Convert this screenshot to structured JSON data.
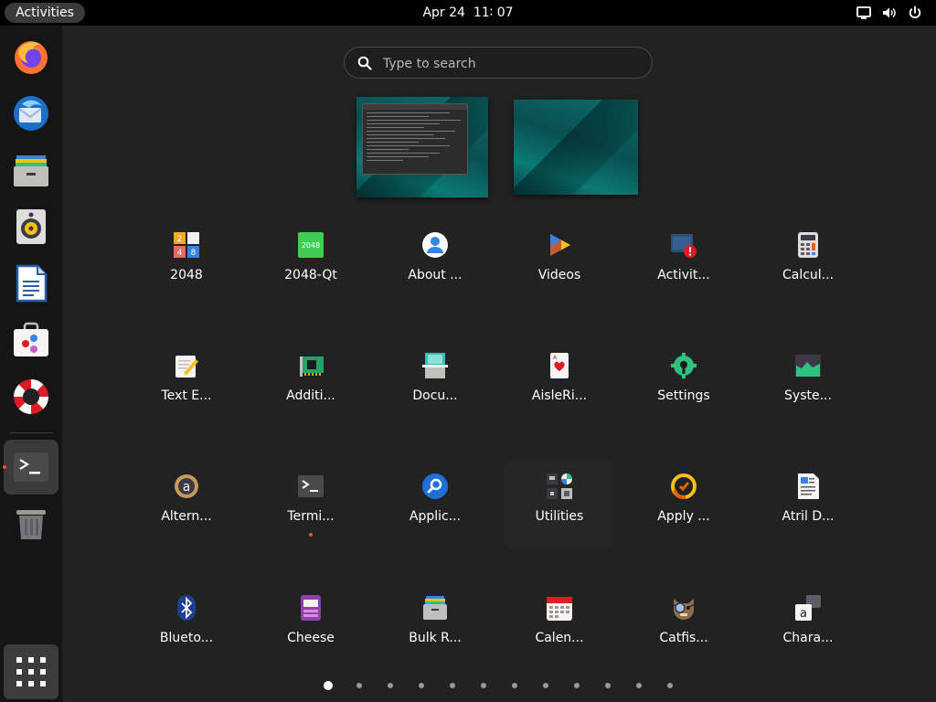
{
  "topbar": {
    "activities": "Activities",
    "date": "Apr 24",
    "time": "11∶ 07",
    "icons": [
      "screen-icon",
      "volume-icon",
      "power-icon"
    ]
  },
  "dock": {
    "favorites": [
      {
        "icon": "firefox-icon"
      },
      {
        "icon": "thunderbird-icon"
      },
      {
        "icon": "files-icon"
      },
      {
        "icon": "rhythmbox-icon"
      },
      {
        "icon": "writer-icon"
      },
      {
        "icon": "software-icon"
      },
      {
        "icon": "help-icon"
      }
    ],
    "running": [
      {
        "icon": "terminal-icon",
        "active": true
      }
    ],
    "trash": {
      "icon": "trash-icon"
    },
    "show_apps": {
      "icon": "grid-icon"
    }
  },
  "search": {
    "placeholder": "Type to search",
    "value": ""
  },
  "workspaces": [
    {
      "has_window": true
    },
    {
      "has_window": false
    }
  ],
  "apps": [
    {
      "label": "2048",
      "icon": "2048-icon"
    },
    {
      "label": "2048-Qt",
      "icon": "2048-qt-icon"
    },
    {
      "label": "About ...",
      "icon": "about-icon"
    },
    {
      "label": "Videos",
      "icon": "videos-icon"
    },
    {
      "label": "Activit...",
      "icon": "activity-log-icon"
    },
    {
      "label": "Calcul...",
      "icon": "calculator-icon"
    },
    {
      "label": "Text E...",
      "icon": "text-editor-icon"
    },
    {
      "label": "Additi...",
      "icon": "additional-drivers-icon"
    },
    {
      "label": "Docu...",
      "icon": "document-scanner-icon"
    },
    {
      "label": "AisleRi...",
      "icon": "aisleriot-icon"
    },
    {
      "label": "Settings",
      "icon": "settings-icon"
    },
    {
      "label": "Syste...",
      "icon": "system-monitor-icon"
    },
    {
      "label": "Altern...",
      "icon": "alternatives-icon"
    },
    {
      "label": "Termi...",
      "icon": "terminal-icon",
      "running": true
    },
    {
      "label": "Applic...",
      "icon": "app-finder-icon"
    },
    {
      "label": "Utilities",
      "icon": "utilities-folder-icon",
      "folder": true
    },
    {
      "label": "Apply ...",
      "icon": "apply-icon"
    },
    {
      "label": "Atril D...",
      "icon": "atril-icon"
    },
    {
      "label": "Blueto...",
      "icon": "bluetooth-icon"
    },
    {
      "label": "Cheese",
      "icon": "cheese-icon"
    },
    {
      "label": "Bulk R...",
      "icon": "bulk-rename-icon"
    },
    {
      "label": "Calen...",
      "icon": "calendar-icon"
    },
    {
      "label": "Catfis...",
      "icon": "catfish-icon"
    },
    {
      "label": "Chara...",
      "icon": "characters-icon"
    }
  ],
  "pagination": {
    "pages": 12,
    "current": 1
  },
  "colors": {
    "background": "#222222",
    "topbar": "#000000",
    "dock": "#151515",
    "accent": "#e95420"
  }
}
